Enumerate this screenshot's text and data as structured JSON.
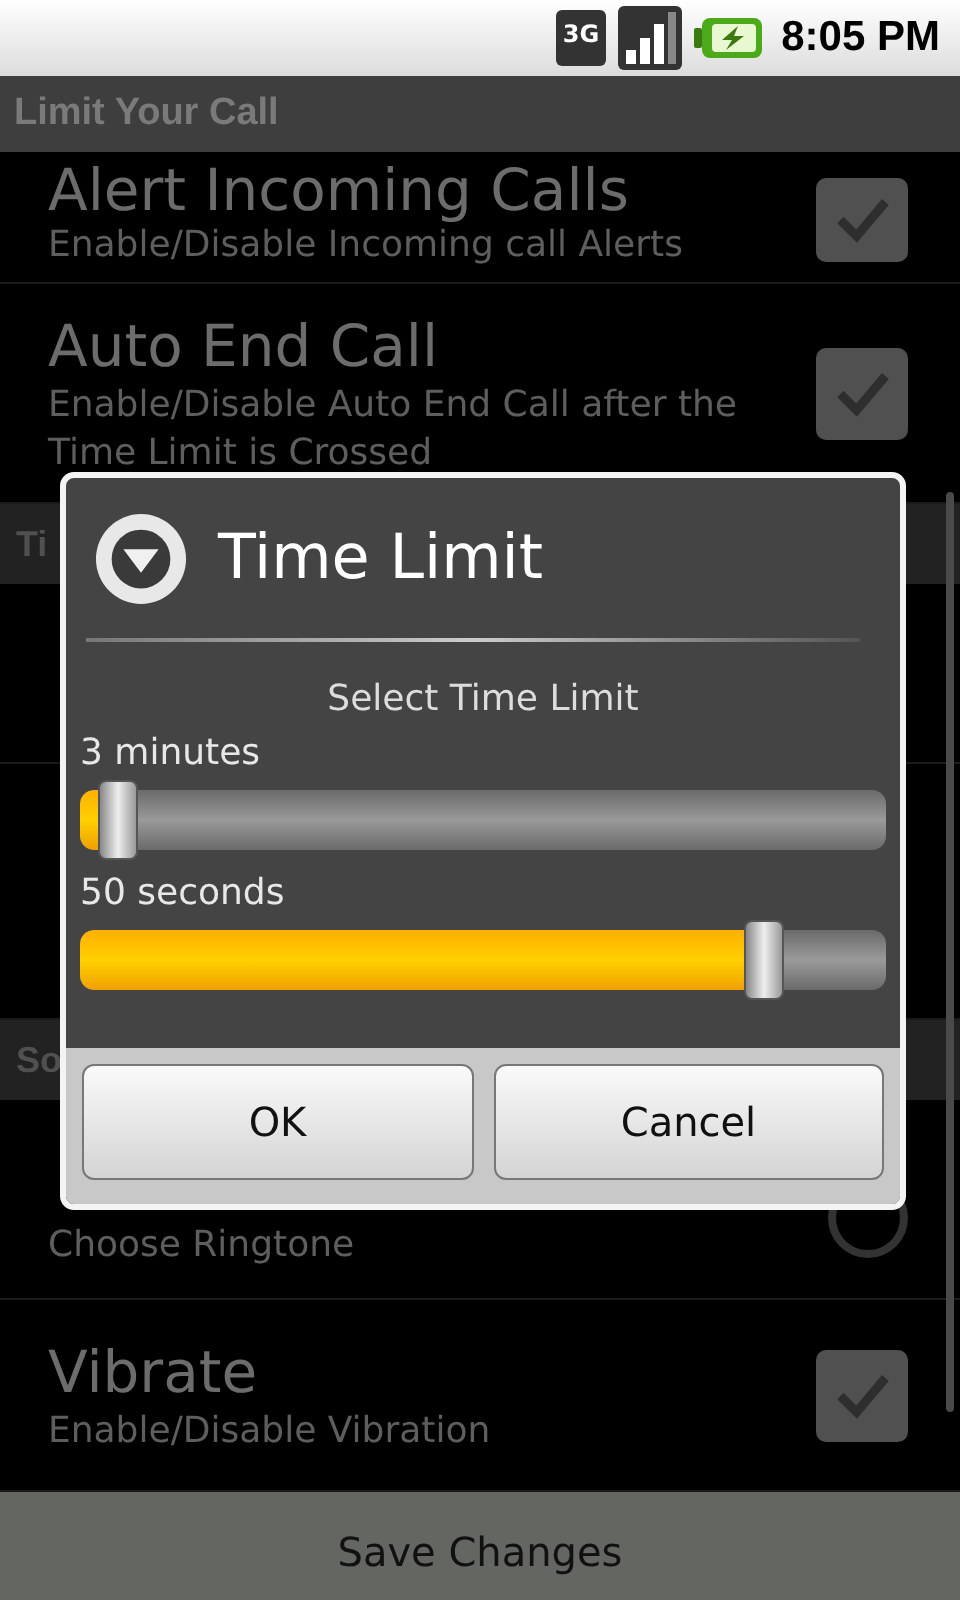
{
  "status_bar": {
    "network": "3G",
    "time": "8:05 PM"
  },
  "window": {
    "title": "Limit Your Call"
  },
  "preferences": [
    {
      "kind": "checkbox",
      "title": "Alert Incoming Calls",
      "summary": "Enable/Disable Incoming call Alerts",
      "checked": true
    },
    {
      "kind": "checkbox",
      "title": "Auto End Call",
      "summary": "Enable/Disable Auto End Call after the Time Limit is Crossed",
      "checked": true
    },
    {
      "kind": "header",
      "title": "Ti"
    },
    {
      "kind": "covered"
    },
    {
      "kind": "covered"
    },
    {
      "kind": "header",
      "title": "So"
    },
    {
      "kind": "radio",
      "summary": "Choose Ringtone"
    },
    {
      "kind": "checkbox",
      "title": "Vibrate",
      "summary": "Enable/Disable Vibration",
      "checked": true
    }
  ],
  "dialog": {
    "title": "Time Limit",
    "message": "Select Time Limit",
    "sliders": [
      {
        "label": "3 minutes",
        "level": 0.05
      },
      {
        "label": "50 seconds",
        "level": 0.85
      }
    ],
    "buttons": [
      "OK",
      "Cancel"
    ]
  },
  "bottom_button": "Save Changes"
}
